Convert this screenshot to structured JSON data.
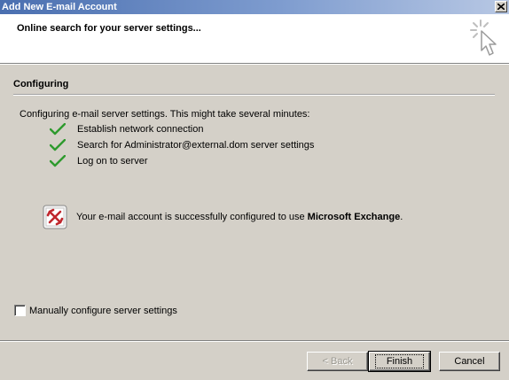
{
  "window": {
    "title": "Add New E-mail Account"
  },
  "header": {
    "title": "Online search for your server settings..."
  },
  "section": {
    "title": "Configuring",
    "intro": "Configuring e-mail server settings. This might take several minutes:",
    "steps": [
      {
        "label": "Establish network connection",
        "status": "done"
      },
      {
        "label": "Search for Administrator@external.dom server settings",
        "status": "done"
      },
      {
        "label": "Log on to server",
        "status": "done"
      }
    ]
  },
  "result": {
    "text_prefix": "Your e-mail account is successfully configured to use ",
    "product": "Microsoft Exchange",
    "text_suffix": ".",
    "icon": "exchange-icon"
  },
  "manual_config": {
    "label": "Manually configure server settings",
    "checked": false
  },
  "buttons": {
    "back": "< Back",
    "finish": "Finish",
    "cancel": "Cancel"
  },
  "colors": {
    "check_green": "#2e9a2e",
    "titlebar": "#4a6fb0"
  }
}
